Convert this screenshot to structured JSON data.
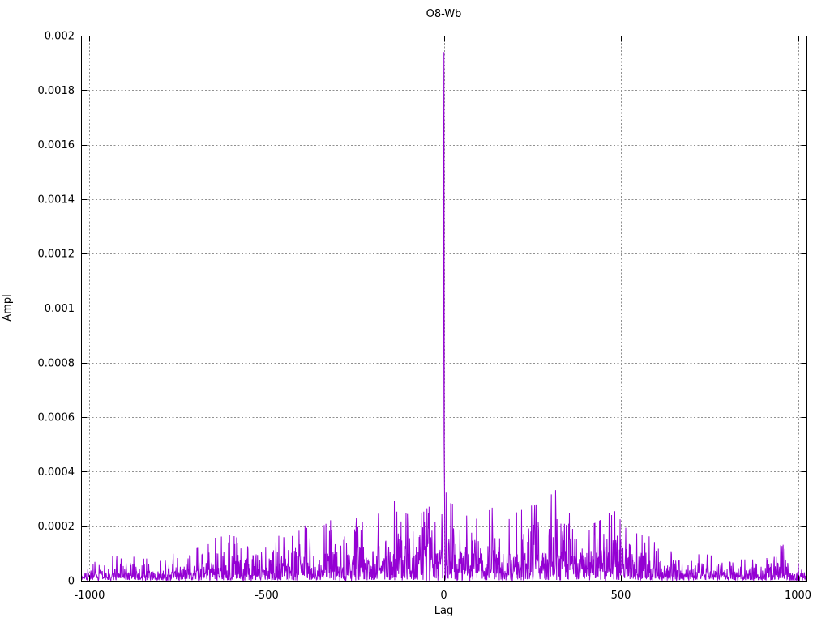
{
  "window": {
    "background_color": "#ffffff",
    "text_color": "#000000"
  },
  "chart_data": {
    "type": "line",
    "title": "O8-Wb",
    "xlabel": "Lag",
    "ylabel": "Ampl",
    "xlim": [
      -1024,
      1024
    ],
    "ylim": [
      0,
      0.002
    ],
    "grid": true,
    "legend_position": "none",
    "line_color": "#9400d3",
    "grid_color": "#909090",
    "border_color": "#000000",
    "x_ticks": [
      {
        "v": -1000,
        "label": "-1000"
      },
      {
        "v": -500,
        "label": "-500"
      },
      {
        "v": 0,
        "label": "0"
      },
      {
        "v": 500,
        "label": "500"
      },
      {
        "v": 1000,
        "label": "1000"
      }
    ],
    "y_ticks": [
      {
        "v": 0,
        "label": "0"
      },
      {
        "v": 0.0002,
        "label": "0.0002"
      },
      {
        "v": 0.0004,
        "label": "0.0004"
      },
      {
        "v": 0.0006,
        "label": "0.0006"
      },
      {
        "v": 0.0008,
        "label": "0.0008"
      },
      {
        "v": 0.001,
        "label": "0.001"
      },
      {
        "v": 0.0012,
        "label": "0.0012"
      },
      {
        "v": 0.0014,
        "label": "0.0014"
      },
      {
        "v": 0.0016,
        "label": "0.0016"
      },
      {
        "v": 0.0018,
        "label": "0.0018"
      },
      {
        "v": 0.002,
        "label": "0.002"
      }
    ],
    "n_points": 2048,
    "peak": {
      "lag": 0,
      "ampl": 0.00194,
      "shape": [
        [
          -3,
          0.00022
        ],
        [
          -2,
          0.00055
        ],
        [
          -1,
          0.0014
        ],
        [
          0,
          0.00194
        ],
        [
          1,
          0.00115
        ],
        [
          2,
          0.0005
        ],
        [
          3,
          0.00022
        ]
      ]
    },
    "noise": {
      "seed": 1337,
      "exp_scale": 0.34,
      "clip": 1.3
    },
    "noise_envelope": [
      [
        -1024,
        5e-05
      ],
      [
        -960,
        5.5e-05
      ],
      [
        -900,
        9e-05
      ],
      [
        -860,
        6e-05
      ],
      [
        -800,
        7e-05
      ],
      [
        -740,
        8e-05
      ],
      [
        -700,
        9e-05
      ],
      [
        -650,
        0.00012
      ],
      [
        -600,
        0.00013
      ],
      [
        -560,
        0.00011
      ],
      [
        -520,
        0.00012
      ],
      [
        -480,
        0.00013
      ],
      [
        -440,
        0.00012
      ],
      [
        -400,
        0.00016
      ],
      [
        -360,
        0.00014
      ],
      [
        -320,
        0.00017
      ],
      [
        -280,
        0.00023
      ],
      [
        -240,
        0.00021
      ],
      [
        -200,
        0.00017
      ],
      [
        -160,
        0.00022
      ],
      [
        -120,
        0.00023
      ],
      [
        -80,
        0.00018
      ],
      [
        -40,
        0.00021
      ],
      [
        0,
        0.00026
      ],
      [
        40,
        0.00019
      ],
      [
        80,
        0.00018
      ],
      [
        120,
        0.00025
      ],
      [
        160,
        0.00018
      ],
      [
        200,
        0.00019
      ],
      [
        240,
        0.00021
      ],
      [
        280,
        0.00022
      ],
      [
        320,
        0.00026
      ],
      [
        360,
        0.00018
      ],
      [
        400,
        0.00015
      ],
      [
        440,
        0.00017
      ],
      [
        480,
        0.0002
      ],
      [
        520,
        0.00014
      ],
      [
        560,
        0.00013
      ],
      [
        600,
        0.00012
      ],
      [
        640,
        0.0001
      ],
      [
        680,
        9e-05
      ],
      [
        720,
        8e-05
      ],
      [
        760,
        7e-05
      ],
      [
        800,
        7e-05
      ],
      [
        840,
        6e-05
      ],
      [
        880,
        6e-05
      ],
      [
        920,
        8e-05
      ],
      [
        950,
        0.00012
      ],
      [
        980,
        5e-05
      ],
      [
        1024,
        5e-05
      ]
    ]
  }
}
